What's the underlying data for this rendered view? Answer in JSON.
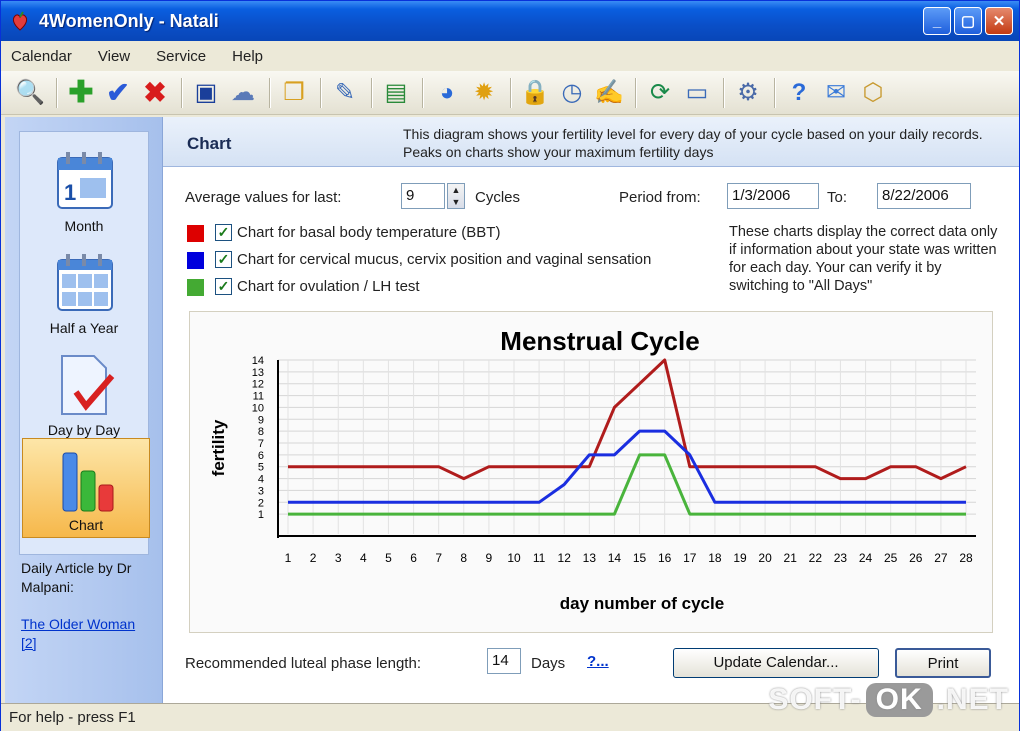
{
  "window": {
    "title": "4WomenOnly - Natali",
    "controls": [
      "minimize-icon",
      "maximize-icon",
      "close-icon"
    ]
  },
  "menu": {
    "items": [
      "Calendar",
      "View",
      "Service",
      "Help"
    ]
  },
  "toolbar": {
    "icons": [
      "find-icon",
      "add-icon",
      "check-icon",
      "delete-icon",
      "save-icon",
      "print-preview-icon",
      "copy-icon",
      "edit-icon",
      "layout-icon",
      "pie-chart-icon",
      "sun-icon",
      "lock-icon",
      "clock-icon",
      "notes-icon",
      "refresh-icon",
      "window-icon",
      "settings-icon",
      "help-icon",
      "mail-icon",
      "box-icon"
    ]
  },
  "sidebar": {
    "items": [
      {
        "label": "Month",
        "icon": "calendar-month-icon"
      },
      {
        "label": "Half a Year",
        "icon": "calendar-halfyear-icon"
      },
      {
        "label": "Day by Day",
        "icon": "checklist-icon"
      },
      {
        "label": "Chart",
        "icon": "bar-chart-icon"
      }
    ],
    "article_heading": "Daily Article by Dr Malpani:",
    "article_link": "The Older Woman",
    "article_link_count": "[2]"
  },
  "header": {
    "title": "Chart",
    "description": "This diagram shows your fertility level for every day of your cycle based on your daily records. Peaks on charts show your maximum fertility days"
  },
  "controls": {
    "average_label": "Average values for last:",
    "cycles_value": "9",
    "cycles_label": "Cycles",
    "period_from_label": "Period from:",
    "period_from": "1/3/2006",
    "to_label": "To:",
    "period_to": "8/22/2006",
    "checkboxes": [
      {
        "label": "Chart for basal body temperature (BBT)",
        "color": "#dd0000",
        "checked": true
      },
      {
        "label": "Chart for cervical mucus, cervix position and vaginal sensation",
        "color": "#0000dd",
        "checked": true
      },
      {
        "label": "Chart for ovulation / LH test",
        "color": "#44aa33",
        "checked": true
      }
    ],
    "note": "These charts display the correct data only if information about your state was written for each day. Your can verify it by switching to \"All Days\"",
    "luteal_label": "Recommended luteal phase length:",
    "luteal_value": "14",
    "days_label": "Days",
    "help_link": "?...",
    "update_button": "Update Calendar...",
    "print_button": "Print"
  },
  "status": {
    "text": "For help - press F1"
  },
  "watermark": {
    "left": "SOFT-",
    "pill": "OK",
    "right": ".NET"
  },
  "chart_data": {
    "type": "line",
    "title": "Menstrual Cycle",
    "xlabel": "day number of cycle",
    "ylabel": "fertility",
    "x": [
      1,
      2,
      3,
      4,
      5,
      6,
      7,
      8,
      9,
      10,
      11,
      12,
      13,
      14,
      15,
      16,
      17,
      18,
      19,
      20,
      21,
      22,
      23,
      24,
      25,
      26,
      27,
      28
    ],
    "ylim": [
      0,
      14
    ],
    "yticks": [
      1,
      2,
      3,
      4,
      5,
      6,
      7,
      8,
      9,
      10,
      11,
      12,
      13,
      14
    ],
    "grid": true,
    "series": [
      {
        "color": "#b01c1c",
        "values": [
          5,
          5,
          5,
          5,
          5,
          5,
          5,
          4,
          5,
          5,
          5,
          5,
          5,
          10,
          12,
          14,
          5,
          5,
          5,
          5,
          5,
          5,
          4,
          4,
          5,
          5,
          4,
          5
        ]
      },
      {
        "color": "#1a2ee0",
        "values": [
          2,
          2,
          2,
          2,
          2,
          2,
          2,
          2,
          2,
          2,
          2,
          3.5,
          6,
          6,
          8,
          8,
          6,
          2,
          2,
          2,
          2,
          2,
          2,
          2,
          2,
          2,
          2,
          2
        ]
      },
      {
        "color": "#49b43c",
        "values": [
          1,
          1,
          1,
          1,
          1,
          1,
          1,
          1,
          1,
          1,
          1,
          1,
          1,
          1,
          6,
          6,
          1,
          1,
          1,
          1,
          1,
          1,
          1,
          1,
          1,
          1,
          1,
          1
        ]
      }
    ]
  }
}
